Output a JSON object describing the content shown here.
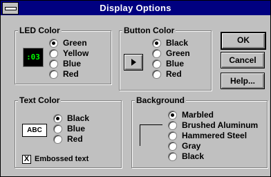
{
  "window": {
    "title": "Display Options"
  },
  "led_color": {
    "label": "LED Color",
    "preview": ":03",
    "options": [
      "Green",
      "Yellow",
      "Blue",
      "Red"
    ],
    "selected": "Green"
  },
  "button_color": {
    "label": "Button Color",
    "options": [
      "Black",
      "Green",
      "Blue",
      "Red"
    ],
    "selected": "Black"
  },
  "text_color": {
    "label": "Text Color",
    "preview": "ABC",
    "options": [
      "Black",
      "Blue",
      "Red"
    ],
    "selected": "Black",
    "embossed_label": "Embossed text",
    "embossed_checked": true,
    "check_mark": "X"
  },
  "background": {
    "label": "Background",
    "options": [
      "Marbled",
      "Brushed Aluminum",
      "Hammered Steel",
      "Gray",
      "Black"
    ],
    "selected": "Marbled"
  },
  "buttons": {
    "ok": "OK",
    "cancel": "Cancel",
    "help": "Help..."
  }
}
